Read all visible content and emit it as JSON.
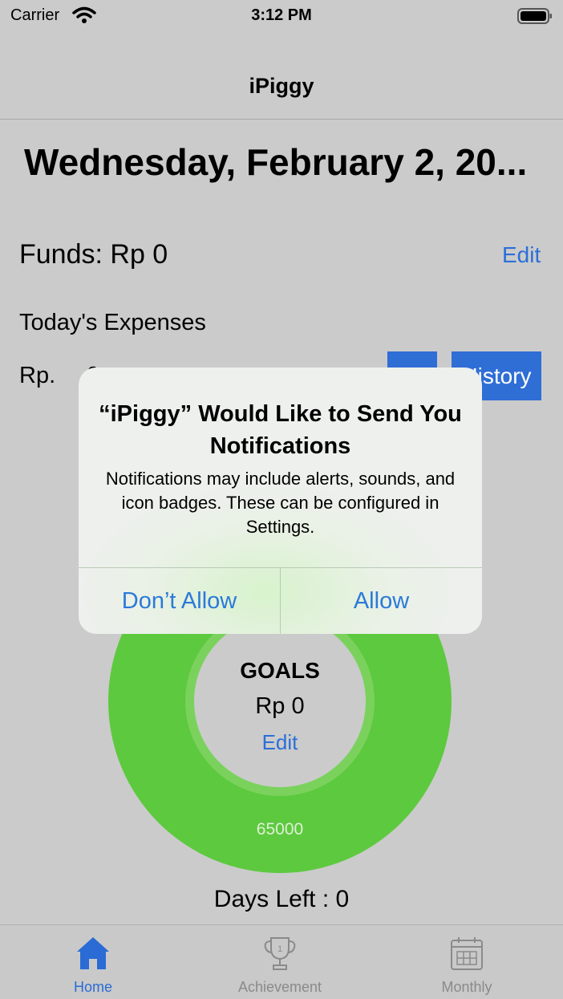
{
  "status_bar": {
    "carrier": "Carrier",
    "time": "3:12 PM"
  },
  "nav": {
    "title": "iPiggy"
  },
  "date_title": "Wednesday, February 2, 20...",
  "funds": {
    "label": "Funds:  Rp 0",
    "edit": "Edit"
  },
  "expenses": {
    "label": "Today's Expenses",
    "currency": "Rp.",
    "value": "0",
    "history_button": "History"
  },
  "goals": {
    "title": "GOALS",
    "value": "Rp 0",
    "edit": "Edit",
    "target": "65000",
    "progress_fraction": 0
  },
  "days_left": "Days Left : 0",
  "tabs": [
    {
      "label": "Home",
      "icon": "home-icon",
      "active": true
    },
    {
      "label": "Achievement",
      "icon": "trophy-icon",
      "active": false
    },
    {
      "label": "Monthly",
      "icon": "calendar-icon",
      "active": false
    }
  ],
  "alert": {
    "title": "“iPiggy” Would Like to Send You Notifications",
    "message": "Notifications may include alerts, sounds, and icon badges. These can be configured in Settings.",
    "deny": "Don’t Allow",
    "allow": "Allow"
  },
  "colors": {
    "accent": "#2f6ed5",
    "ring": "#5dc93e",
    "background": "#cbcbcb"
  }
}
